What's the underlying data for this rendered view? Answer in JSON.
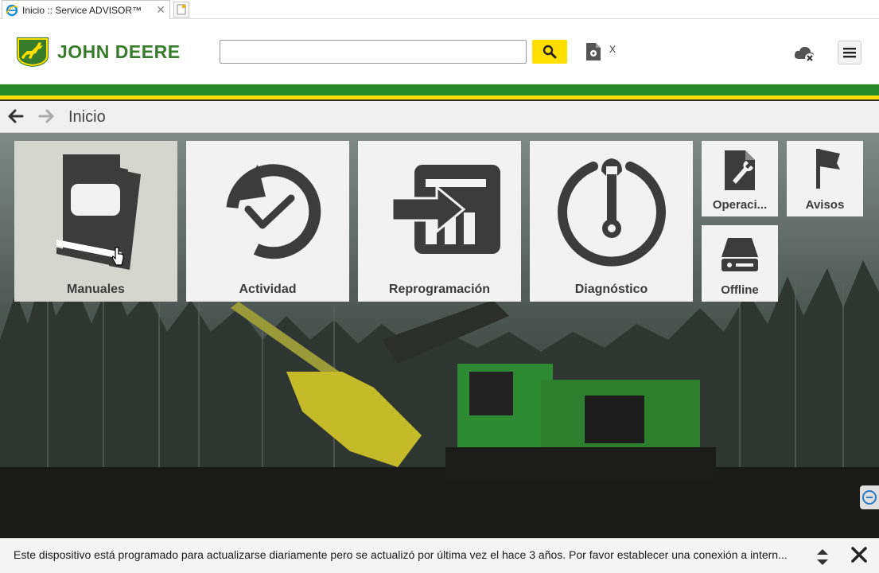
{
  "browser": {
    "tab_title": "Inicio :: Service ADVISOR™",
    "tab_close": "✕"
  },
  "header": {
    "brand_name": "JOHN DEERE",
    "search": {
      "value": "",
      "placeholder": ""
    },
    "doc_close": "X"
  },
  "breadcrumb": {
    "title": "Inicio"
  },
  "tiles": [
    {
      "label": "Manuales",
      "icon": "manuals-icon"
    },
    {
      "label": "Actividad",
      "icon": "activity-icon"
    },
    {
      "label": "Reprogramación",
      "icon": "reprogramming-icon"
    },
    {
      "label": "Diagnóstico",
      "icon": "diagnostics-icon"
    },
    {
      "label": "Operaci...",
      "icon": "operations-icon"
    },
    {
      "label": "Avisos",
      "icon": "flag-icon"
    },
    {
      "label": "Offline",
      "icon": "offline-drive-icon"
    }
  ],
  "status": {
    "message": "Este dispositivo está programado para actualizarse diariamente pero se actualizó por última vez el hace 3 años. Por favor establecer una conexión a intern..."
  },
  "colors": {
    "brand_green": "#367c2b",
    "stripe_green": "#2a8a2a",
    "brand_yellow": "#ffde00",
    "tile_bg": "#f2f2f2",
    "icon_dark": "#3c3c3c"
  }
}
